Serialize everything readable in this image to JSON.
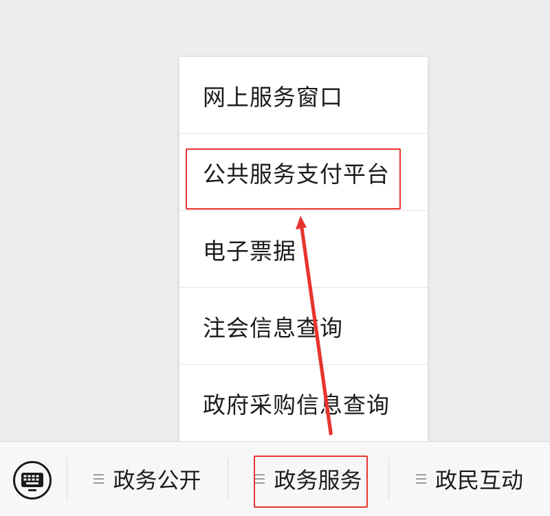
{
  "submenu": {
    "items": [
      {
        "label": "网上服务窗口"
      },
      {
        "label": "公共服务支付平台"
      },
      {
        "label": "电子票据"
      },
      {
        "label": "注会信息查询"
      },
      {
        "label": "政府采购信息查询"
      }
    ]
  },
  "menubar": {
    "keyboard_icon": "keyboard-icon",
    "menu_icon": "menu-lines-icon",
    "tabs": [
      {
        "label": "政务公开"
      },
      {
        "label": "政务服务"
      },
      {
        "label": "政民互动"
      }
    ]
  },
  "annotation": {
    "color": "#e8332e"
  }
}
